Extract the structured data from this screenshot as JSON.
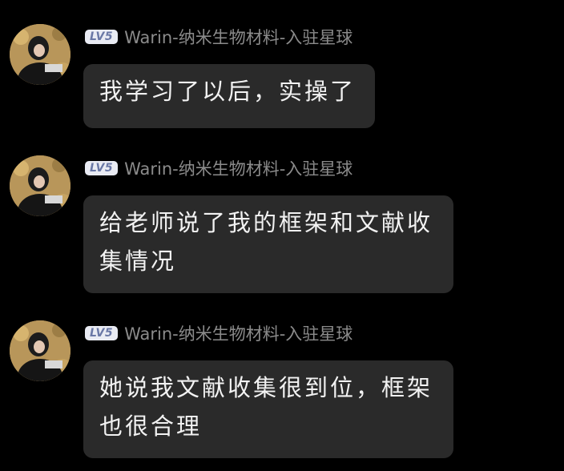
{
  "messages": [
    {
      "level": "LV5",
      "sender": "Warin-纳米生物材料-入驻星球",
      "text": "我学习了以后，实操了"
    },
    {
      "level": "LV5",
      "sender": "Warin-纳米生物材料-入驻星球",
      "text": "给老师说了我的框架和文献收集情况"
    },
    {
      "level": "LV5",
      "sender": "Warin-纳米生物材料-入驻星球",
      "text": "她说我文献收集很到位，框架也很合理"
    }
  ],
  "colors": {
    "background": "#000000",
    "bubble": "#2a2a2a",
    "bubble_text": "#f2f2f2",
    "sender_text": "#8b8b8b",
    "level_badge_bg": "#e9ebf3",
    "level_badge_text": "#6a78a6"
  },
  "icons": [
    "avatar-photo"
  ]
}
